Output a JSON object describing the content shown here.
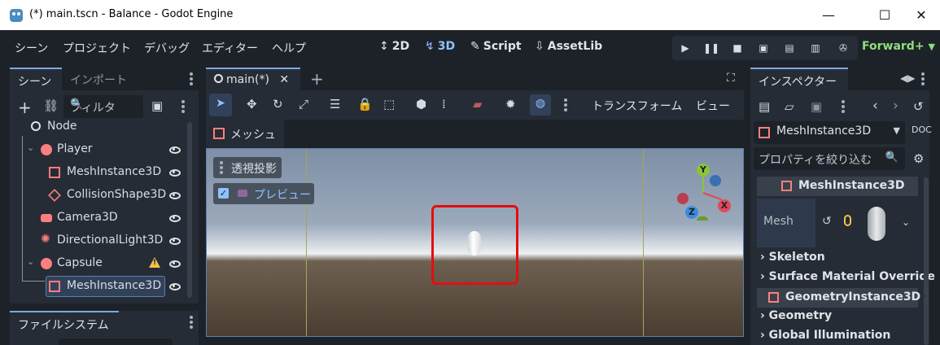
{
  "window": {
    "title": "(*) main.tscn - Balance - Godot Engine",
    "minimize": "—",
    "maximize": "☐",
    "close": "✕"
  },
  "menu": [
    "シーン",
    "プロジェクト",
    "デバッグ",
    "エディター",
    "ヘルプ"
  ],
  "modes": [
    {
      "label": "2D",
      "icon": "↕"
    },
    {
      "label": "3D",
      "icon": "↯"
    },
    {
      "label": "Script",
      "icon": "✎"
    },
    {
      "label": "AssetLib",
      "icon": "⇩"
    }
  ],
  "renderer": "Forward+",
  "scene_panel": {
    "tabs": [
      "シーン",
      "インポート"
    ],
    "filter_placeholder": "フィルタ",
    "tree": [
      {
        "label": "Node",
        "icon": "circle-icon"
      },
      {
        "label": "Player",
        "icon": "node3d-icon"
      },
      {
        "label": "MeshInstance3D",
        "icon": "mesh-icon"
      },
      {
        "label": "CollisionShape3D",
        "icon": "collision-icon"
      },
      {
        "label": "Camera3D",
        "icon": "camera-icon"
      },
      {
        "label": "DirectionalLight3D",
        "icon": "light-icon"
      },
      {
        "label": "Capsule",
        "icon": "node3d-icon"
      },
      {
        "label": "MeshInstance3D",
        "icon": "mesh-icon"
      }
    ]
  },
  "filesystem_panel": {
    "tab": "ファイルシステム"
  },
  "editor": {
    "tab": "main(*)",
    "add_tab": "+",
    "toolbar_transform": "トランスフォーム",
    "toolbar_view": "ビュー",
    "mesh_menu": "メッシュ",
    "perspective": "透視投影",
    "preview": "プレビュー",
    "gizmo": {
      "y": "Y",
      "x": "X",
      "z": "Z"
    }
  },
  "inspector": {
    "tab": "インスペクター",
    "node_type": "MeshInstance3D",
    "filter_placeholder": "プロパティを絞り込む",
    "class_header": "MeshInstance3D",
    "mesh_label": "Mesh",
    "sections": [
      "Skeleton",
      "Surface Material Override"
    ],
    "class_header2": "GeometryInstance3D",
    "sections2": [
      "Geometry",
      "Global Illumination"
    ]
  }
}
